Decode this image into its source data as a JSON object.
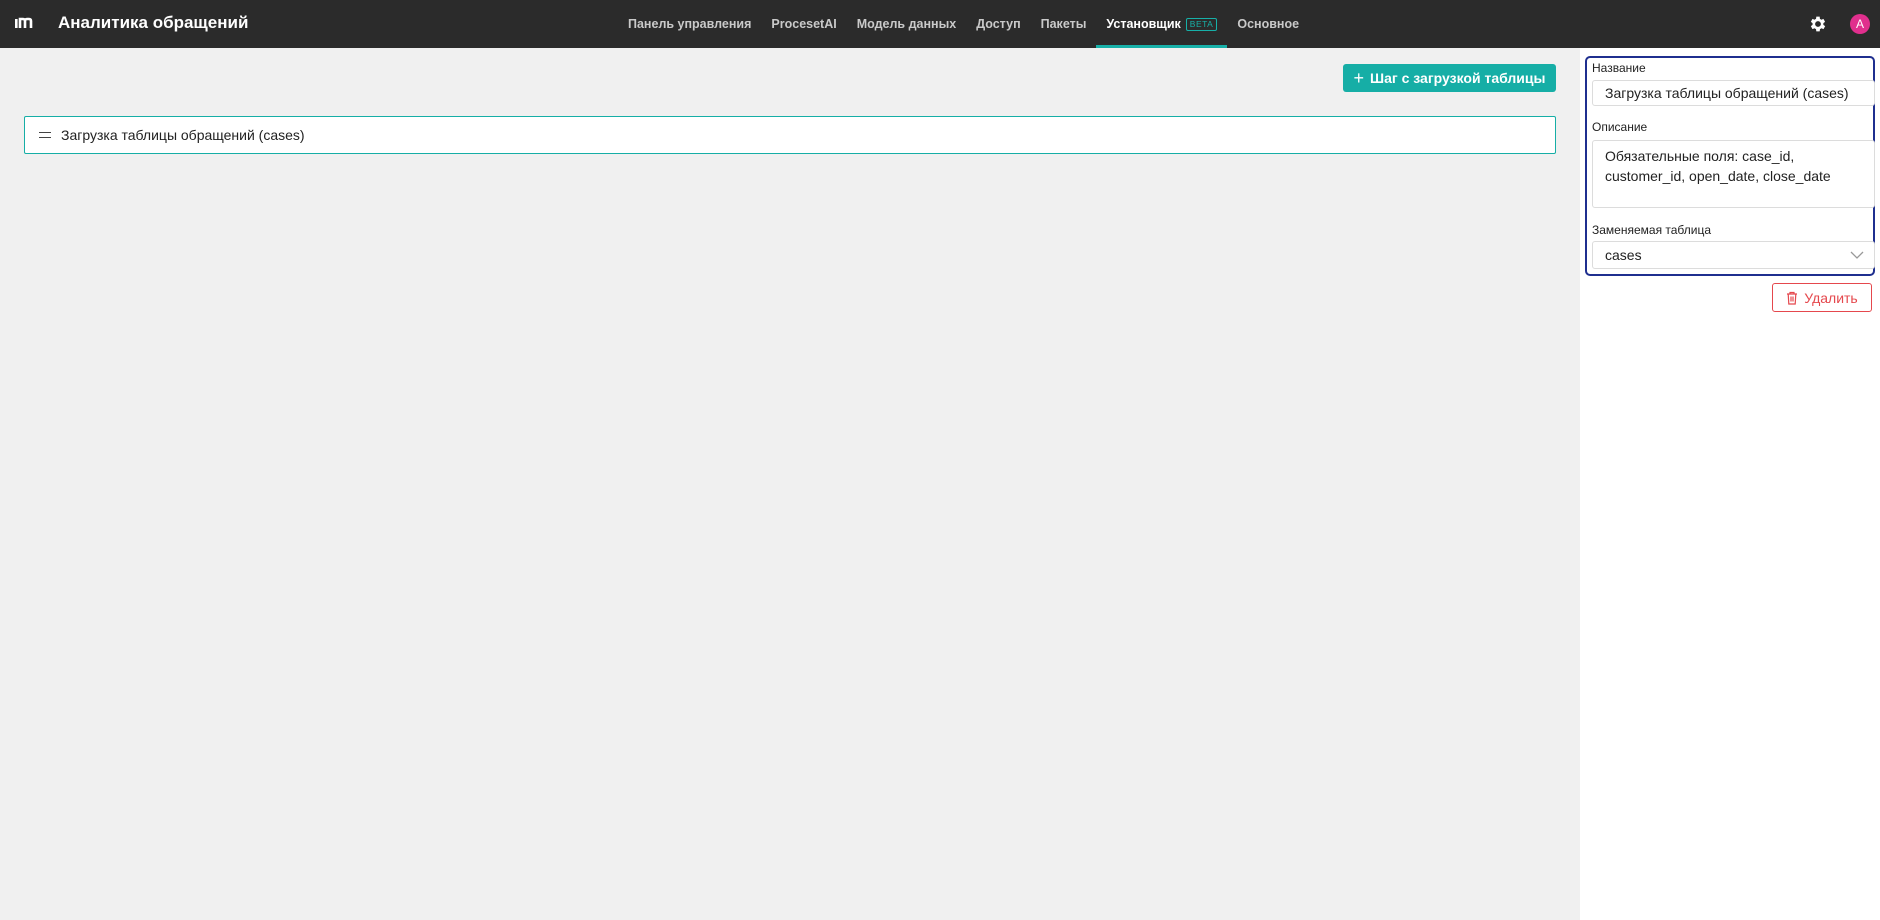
{
  "app": {
    "title": "Аналитика обращений",
    "logo_text": "ım"
  },
  "nav": {
    "items": [
      {
        "label": "Панель управления",
        "active": false
      },
      {
        "label": "ProcesetAI",
        "active": false
      },
      {
        "label": "Модель данных",
        "active": false
      },
      {
        "label": "Доступ",
        "active": false
      },
      {
        "label": "Пакеты",
        "active": false
      },
      {
        "label": "Установщик",
        "active": true,
        "badge": "BETA"
      },
      {
        "label": "Основное",
        "active": false
      }
    ]
  },
  "header_right": {
    "settings_icon": "gear-icon",
    "avatar_letter": "A",
    "avatar_color": "#e02f8d"
  },
  "main": {
    "add_step_label": "Шаг с загрузкой таблицы",
    "steps": [
      {
        "title": "Загрузка таблицы обращений (cases)"
      }
    ]
  },
  "panel": {
    "name_label": "Название",
    "name_value": "Загрузка таблицы обращений (cases)",
    "description_label": "Описание",
    "description_value": "Обязательные поля: case_id, customer_id, open_date, close_date",
    "replaced_table_label": "Заменяемая таблица",
    "replaced_table_value": "cases",
    "delete_label": "Удалить"
  },
  "colors": {
    "accent": "#16aea6",
    "topbar": "#2b2b2b",
    "danger": "#e5484d",
    "selection": "#1f2f8f"
  }
}
